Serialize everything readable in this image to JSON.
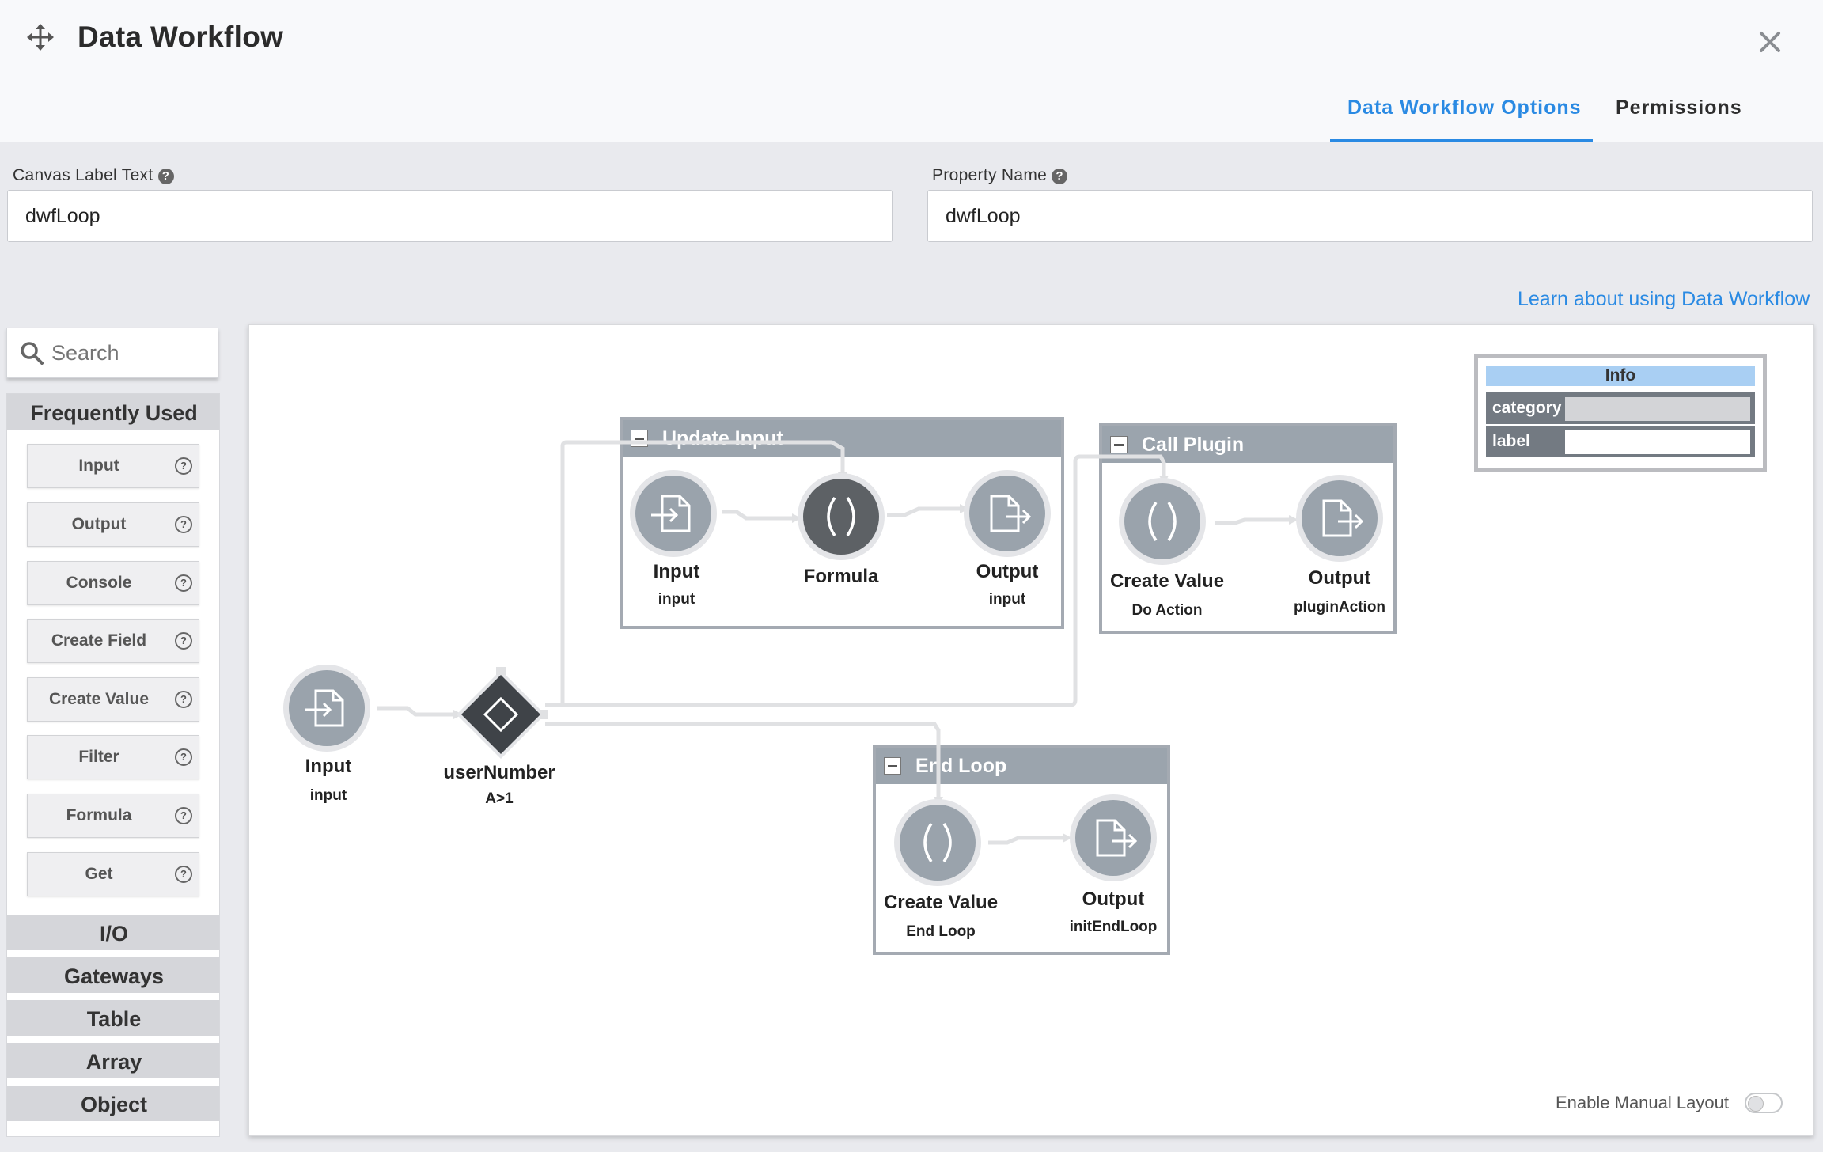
{
  "header": {
    "title": "Data Workflow",
    "tabs": [
      {
        "label": "Data Workflow Options",
        "active": true
      },
      {
        "label": "Permissions",
        "active": false
      }
    ]
  },
  "fields": {
    "canvas_label": {
      "label": "Canvas Label Text",
      "value": "dwfLoop"
    },
    "property_name": {
      "label": "Property Name",
      "value": "dwfLoop"
    }
  },
  "learn_link": "Learn about using Data Workflow",
  "palette": {
    "search_placeholder": "Search",
    "active_section": "Frequently Used",
    "items": [
      "Input",
      "Output",
      "Console",
      "Create Field",
      "Create Value",
      "Filter",
      "Formula",
      "Get"
    ],
    "sections": [
      "I/O",
      "Gateways",
      "Table",
      "Array",
      "Object"
    ]
  },
  "canvas": {
    "groups": {
      "update_input": "Update Input",
      "call_plugin": "Call Plugin",
      "end_loop": "End Loop"
    },
    "nodes": {
      "main_input": {
        "label": "Input",
        "sub": "input"
      },
      "gateway": {
        "label": "userNumber",
        "sub": "A>1"
      },
      "ui_input": {
        "label": "Input",
        "sub": "input"
      },
      "ui_formula": {
        "label": "Formula",
        "sub": ""
      },
      "ui_output": {
        "label": "Output",
        "sub": "input"
      },
      "cp_create": {
        "label": "Create Value",
        "sub": "Do Action"
      },
      "cp_output": {
        "label": "Output",
        "sub": "pluginAction"
      },
      "el_create": {
        "label": "Create Value",
        "sub": "End Loop"
      },
      "el_output": {
        "label": "Output",
        "sub": "initEndLoop"
      }
    },
    "info": {
      "title": "Info",
      "rows": [
        {
          "key": "category",
          "value": ""
        },
        {
          "key": "label",
          "value": ""
        }
      ]
    },
    "manual_layout_label": "Enable Manual Layout",
    "manual_layout_enabled": false
  },
  "colors": {
    "accent": "#2a8ae3",
    "node_fill": "#9aa3ac",
    "formula_fill": "#5d6165",
    "gateway_fill": "#3f4348",
    "group_header": "#9ba4ad"
  }
}
